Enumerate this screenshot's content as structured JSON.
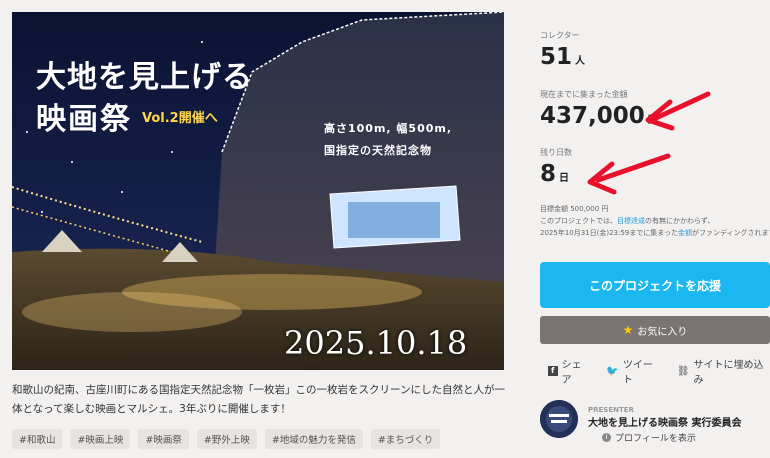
{
  "hero": {
    "title_line1": "大地を見上げる",
    "title_line2": "映画祭",
    "vol": "Vol.2開催へ",
    "tagline1": "高さ100m, 幅500m,",
    "tagline2": "国指定の天然記念物",
    "date": "2025.10.18 (土)"
  },
  "description": "和歌山の紀南、古座川町にある国指定天然記念物「一枚岩」この一枚岩をスクリーンにした自然と人が一体となって楽しむ映画とマルシェ。3年ぶりに開催します！",
  "tags": [
    "#和歌山",
    "#映画上映",
    "#映画祭",
    "#野外上映",
    "#地域の魅力を発信",
    "#まちづくり"
  ],
  "stats": {
    "collector_label": "コレクター",
    "collector_value": "51",
    "collector_unit": "人",
    "amount_label": "現在までに集まった金額",
    "amount_value": "437,000",
    "amount_unit": "円",
    "days_label": "残り日数",
    "days_value": "8",
    "days_unit": "日"
  },
  "notes": {
    "goal": "目標金額 500,000 円",
    "line1_prefix": "このプロジェクトでは、",
    "line1_highlight": "目標達成",
    "line1_suffix": "の有無にかかわらず、",
    "line2_prefix": "2025年10月31日(金)23:59までに集まった",
    "line2_highlight": "金額",
    "line2_suffix": "がファンディングされます。"
  },
  "buttons": {
    "support": "このプロジェクトを応援",
    "favorite": "お気に入り"
  },
  "share": {
    "share": "シェア",
    "tweet": "ツイート",
    "embed": "サイトに埋め込み"
  },
  "presenter": {
    "label": "PRESENTER",
    "name": "大地を見上げる映画祭 実行委員会",
    "profile": "プロフィールを表示"
  },
  "colors": {
    "accent": "#1ab7f0",
    "favorite_bg": "#7a7472",
    "annotation_arrow": "#e8102a"
  },
  "icons": [
    "facebook-icon",
    "twitter-icon",
    "link-icon",
    "star-icon",
    "info-icon",
    "arrow-icon"
  ]
}
